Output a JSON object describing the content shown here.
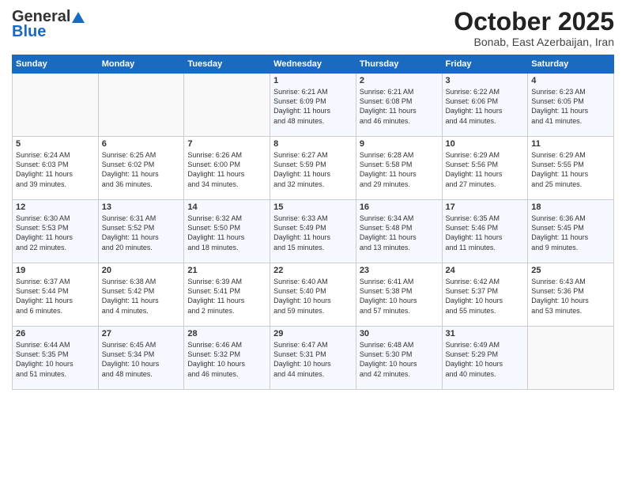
{
  "logo": {
    "general": "General",
    "blue": "Blue"
  },
  "header": {
    "month": "October 2025",
    "location": "Bonab, East Azerbaijan, Iran"
  },
  "days_of_week": [
    "Sunday",
    "Monday",
    "Tuesday",
    "Wednesday",
    "Thursday",
    "Friday",
    "Saturday"
  ],
  "weeks": [
    [
      {
        "day": "",
        "content": ""
      },
      {
        "day": "",
        "content": ""
      },
      {
        "day": "",
        "content": ""
      },
      {
        "day": "1",
        "content": "Sunrise: 6:21 AM\nSunset: 6:09 PM\nDaylight: 11 hours\nand 48 minutes."
      },
      {
        "day": "2",
        "content": "Sunrise: 6:21 AM\nSunset: 6:08 PM\nDaylight: 11 hours\nand 46 minutes."
      },
      {
        "day": "3",
        "content": "Sunrise: 6:22 AM\nSunset: 6:06 PM\nDaylight: 11 hours\nand 44 minutes."
      },
      {
        "day": "4",
        "content": "Sunrise: 6:23 AM\nSunset: 6:05 PM\nDaylight: 11 hours\nand 41 minutes."
      }
    ],
    [
      {
        "day": "5",
        "content": "Sunrise: 6:24 AM\nSunset: 6:03 PM\nDaylight: 11 hours\nand 39 minutes."
      },
      {
        "day": "6",
        "content": "Sunrise: 6:25 AM\nSunset: 6:02 PM\nDaylight: 11 hours\nand 36 minutes."
      },
      {
        "day": "7",
        "content": "Sunrise: 6:26 AM\nSunset: 6:00 PM\nDaylight: 11 hours\nand 34 minutes."
      },
      {
        "day": "8",
        "content": "Sunrise: 6:27 AM\nSunset: 5:59 PM\nDaylight: 11 hours\nand 32 minutes."
      },
      {
        "day": "9",
        "content": "Sunrise: 6:28 AM\nSunset: 5:58 PM\nDaylight: 11 hours\nand 29 minutes."
      },
      {
        "day": "10",
        "content": "Sunrise: 6:29 AM\nSunset: 5:56 PM\nDaylight: 11 hours\nand 27 minutes."
      },
      {
        "day": "11",
        "content": "Sunrise: 6:29 AM\nSunset: 5:55 PM\nDaylight: 11 hours\nand 25 minutes."
      }
    ],
    [
      {
        "day": "12",
        "content": "Sunrise: 6:30 AM\nSunset: 5:53 PM\nDaylight: 11 hours\nand 22 minutes."
      },
      {
        "day": "13",
        "content": "Sunrise: 6:31 AM\nSunset: 5:52 PM\nDaylight: 11 hours\nand 20 minutes."
      },
      {
        "day": "14",
        "content": "Sunrise: 6:32 AM\nSunset: 5:50 PM\nDaylight: 11 hours\nand 18 minutes."
      },
      {
        "day": "15",
        "content": "Sunrise: 6:33 AM\nSunset: 5:49 PM\nDaylight: 11 hours\nand 15 minutes."
      },
      {
        "day": "16",
        "content": "Sunrise: 6:34 AM\nSunset: 5:48 PM\nDaylight: 11 hours\nand 13 minutes."
      },
      {
        "day": "17",
        "content": "Sunrise: 6:35 AM\nSunset: 5:46 PM\nDaylight: 11 hours\nand 11 minutes."
      },
      {
        "day": "18",
        "content": "Sunrise: 6:36 AM\nSunset: 5:45 PM\nDaylight: 11 hours\nand 9 minutes."
      }
    ],
    [
      {
        "day": "19",
        "content": "Sunrise: 6:37 AM\nSunset: 5:44 PM\nDaylight: 11 hours\nand 6 minutes."
      },
      {
        "day": "20",
        "content": "Sunrise: 6:38 AM\nSunset: 5:42 PM\nDaylight: 11 hours\nand 4 minutes."
      },
      {
        "day": "21",
        "content": "Sunrise: 6:39 AM\nSunset: 5:41 PM\nDaylight: 11 hours\nand 2 minutes."
      },
      {
        "day": "22",
        "content": "Sunrise: 6:40 AM\nSunset: 5:40 PM\nDaylight: 10 hours\nand 59 minutes."
      },
      {
        "day": "23",
        "content": "Sunrise: 6:41 AM\nSunset: 5:38 PM\nDaylight: 10 hours\nand 57 minutes."
      },
      {
        "day": "24",
        "content": "Sunrise: 6:42 AM\nSunset: 5:37 PM\nDaylight: 10 hours\nand 55 minutes."
      },
      {
        "day": "25",
        "content": "Sunrise: 6:43 AM\nSunset: 5:36 PM\nDaylight: 10 hours\nand 53 minutes."
      }
    ],
    [
      {
        "day": "26",
        "content": "Sunrise: 6:44 AM\nSunset: 5:35 PM\nDaylight: 10 hours\nand 51 minutes."
      },
      {
        "day": "27",
        "content": "Sunrise: 6:45 AM\nSunset: 5:34 PM\nDaylight: 10 hours\nand 48 minutes."
      },
      {
        "day": "28",
        "content": "Sunrise: 6:46 AM\nSunset: 5:32 PM\nDaylight: 10 hours\nand 46 minutes."
      },
      {
        "day": "29",
        "content": "Sunrise: 6:47 AM\nSunset: 5:31 PM\nDaylight: 10 hours\nand 44 minutes."
      },
      {
        "day": "30",
        "content": "Sunrise: 6:48 AM\nSunset: 5:30 PM\nDaylight: 10 hours\nand 42 minutes."
      },
      {
        "day": "31",
        "content": "Sunrise: 6:49 AM\nSunset: 5:29 PM\nDaylight: 10 hours\nand 40 minutes."
      },
      {
        "day": "",
        "content": ""
      }
    ]
  ]
}
